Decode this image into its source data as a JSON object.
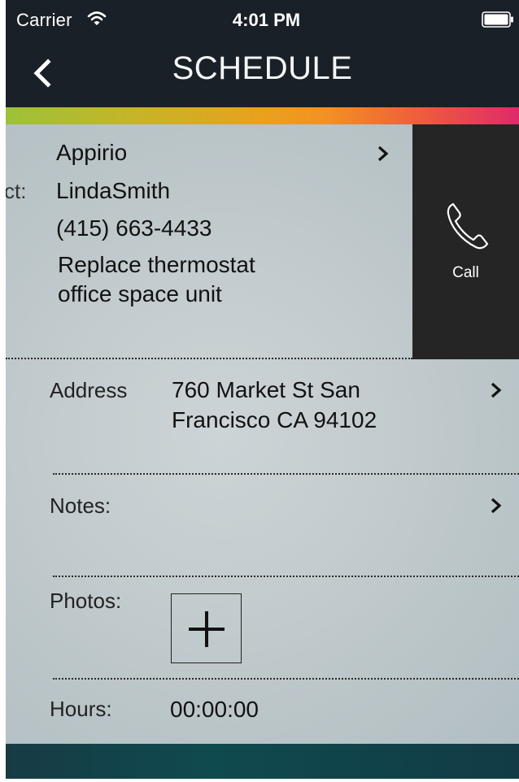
{
  "status_bar": {
    "carrier": "Carrier",
    "time": "4:01 PM"
  },
  "nav": {
    "title": "SCHEDULE"
  },
  "job": {
    "company": "Appirio",
    "contact_label_fragment": "ct:",
    "contact_name": "LindaSmith",
    "phone": "(415) 663-4433",
    "description_line1": "Replace thermostat",
    "description_line2": "office space unit"
  },
  "call_action": {
    "label": "Call"
  },
  "fields": {
    "address_label": "Address",
    "address_line1": "760 Market St San",
    "address_line2": "Francisco CA 94102",
    "notes_label": "Notes:",
    "photos_label": "Photos:",
    "hours_label": "Hours:",
    "hours_value": "00:00:00"
  },
  "icons": {
    "wifi": "wifi-icon",
    "battery": "battery-icon",
    "back": "chevron-left-icon",
    "chevron": "chevron-right-icon",
    "phone": "phone-icon",
    "add": "plus-icon"
  },
  "colors": {
    "nav_background": "#1a2027",
    "call_panel": "#252525",
    "content_background": "#c1cacd",
    "bottom_bar": "#0f4a4f"
  }
}
